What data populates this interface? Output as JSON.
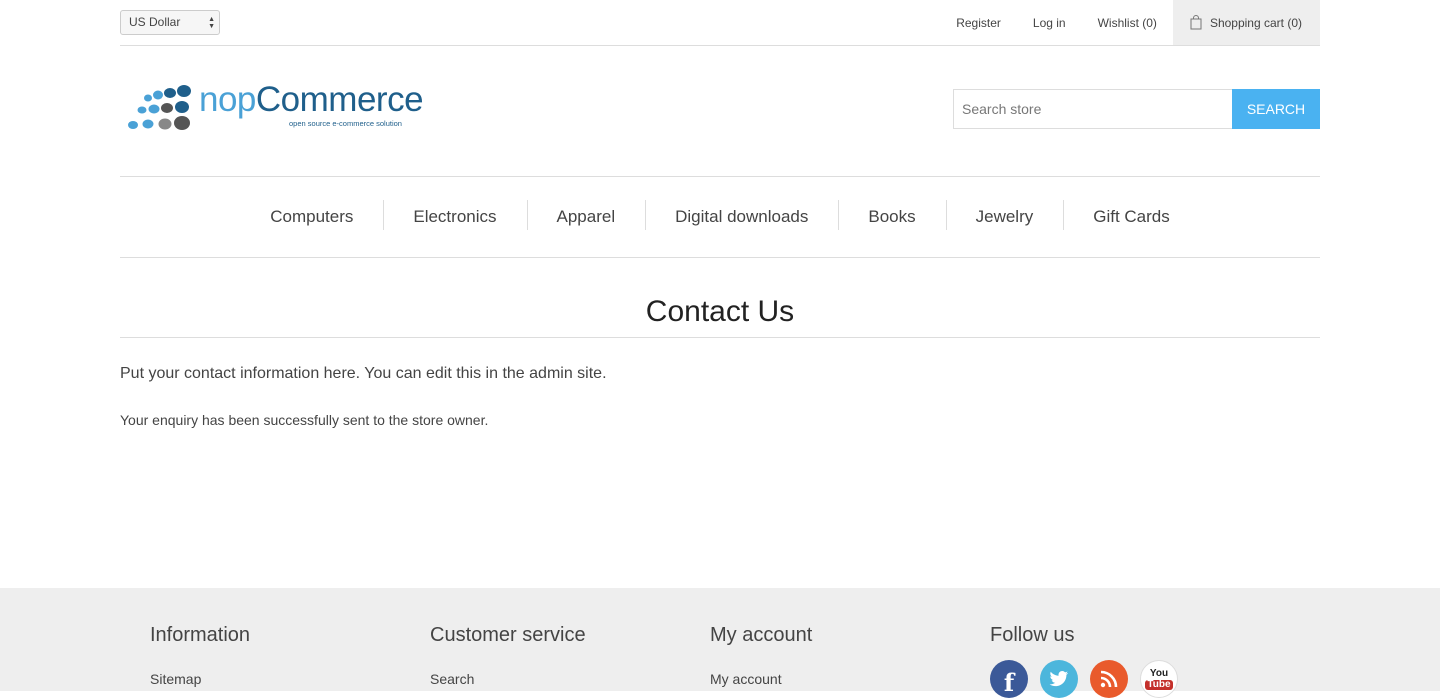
{
  "header": {
    "currency": "US Dollar",
    "links": {
      "register": "Register",
      "login": "Log in",
      "wishlist": "Wishlist (0)",
      "cart": "Shopping cart (0)"
    }
  },
  "logo": {
    "text_prefix": "nop",
    "text_main": "Commerce",
    "tagline": "open source e-commerce solution"
  },
  "search": {
    "placeholder": "Search store",
    "button_label": "Search"
  },
  "menu": {
    "items": [
      "Computers",
      "Electronics",
      "Apparel",
      "Digital downloads",
      "Books",
      "Jewelry",
      "Gift Cards"
    ]
  },
  "page": {
    "title": "Contact Us",
    "topic_text": "Put your contact information here. You can edit this in the admin site.",
    "result_message": "Your enquiry has been successfully sent to the store owner."
  },
  "footer": {
    "information": {
      "title": "Information",
      "first_link": "Sitemap"
    },
    "customer_service": {
      "title": "Customer service",
      "first_link": "Search"
    },
    "my_account": {
      "title": "My account",
      "first_link": "My account"
    },
    "follow_us": {
      "title": "Follow us",
      "icons": [
        "facebook-icon",
        "twitter-icon",
        "rss-icon",
        "youtube-icon"
      ],
      "youtube_label_top": "You",
      "youtube_label_bottom": "Tube"
    }
  },
  "colors": {
    "accent": "#4ab2f1",
    "logo_light": "#4aa1d6",
    "logo_dark": "#1f5f8b",
    "footer_bg": "#eeeeee"
  }
}
